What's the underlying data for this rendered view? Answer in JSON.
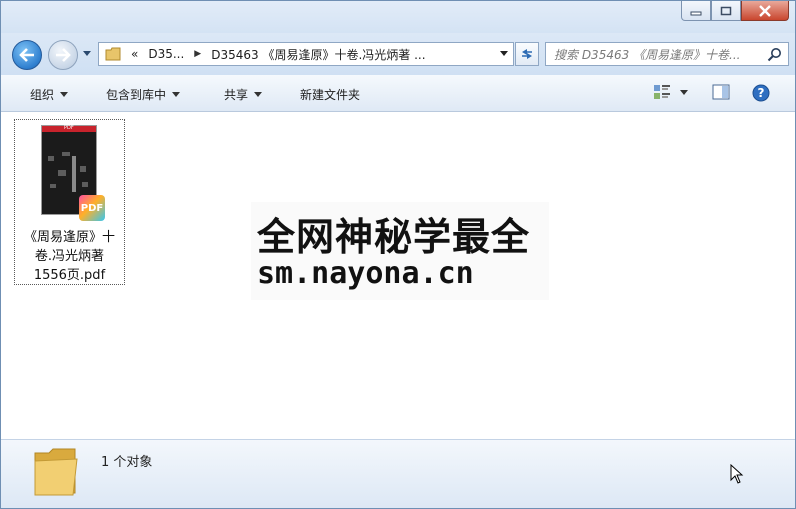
{
  "window": {
    "controls": [
      "minimize",
      "maximize",
      "close"
    ]
  },
  "nav": {
    "breadcrumb_overflow": "«",
    "crumb1": "D35...",
    "crumb2": "D35463 《周易逢原》十卷.冯光炳著 ...",
    "search_placeholder": "搜索 D35463 《周易逢原》十卷..."
  },
  "toolbar": {
    "organize": "组织",
    "include_library": "包含到库中",
    "share": "共享",
    "new_folder": "新建文件夹"
  },
  "files": [
    {
      "name_line1": "《周易逢原》十",
      "name_line2": "卷.冯光炳著",
      "name_line3": "1556页.pdf",
      "thumb_band_text": "PDF",
      "badge": "PDF"
    }
  ],
  "watermark": {
    "line1": "全网神秘学最全",
    "line2": "sm.nayona.cn"
  },
  "details": {
    "count_text": "1 个对象"
  }
}
